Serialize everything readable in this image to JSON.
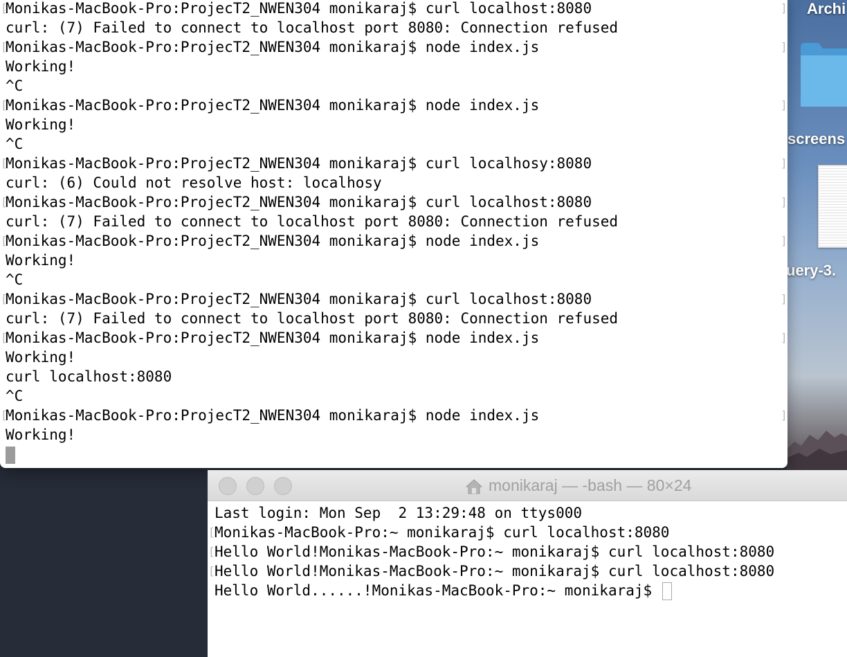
{
  "desktop": {
    "labels": [
      "Archi",
      "screens",
      "uery-3."
    ]
  },
  "terminal_main": {
    "lines": [
      {
        "text": "Monikas-MacBook-Pro:ProjecT2_NWEN304 monikaraj$ curl localhost:8080",
        "prompt": true
      },
      {
        "text": "curl: (7) Failed to connect to localhost port 8080: Connection refused",
        "prompt": false
      },
      {
        "text": "Monikas-MacBook-Pro:ProjecT2_NWEN304 monikaraj$ node index.js",
        "prompt": true
      },
      {
        "text": "Working!",
        "prompt": false
      },
      {
        "text": "^C",
        "prompt": false
      },
      {
        "text": "Monikas-MacBook-Pro:ProjecT2_NWEN304 monikaraj$ node index.js",
        "prompt": true
      },
      {
        "text": "Working!",
        "prompt": false
      },
      {
        "text": "^C",
        "prompt": false
      },
      {
        "text": "Monikas-MacBook-Pro:ProjecT2_NWEN304 monikaraj$ curl localhosy:8080",
        "prompt": true
      },
      {
        "text": "curl: (6) Could not resolve host: localhosy",
        "prompt": false
      },
      {
        "text": "Monikas-MacBook-Pro:ProjecT2_NWEN304 monikaraj$ curl localhost:8080",
        "prompt": true
      },
      {
        "text": "curl: (7) Failed to connect to localhost port 8080: Connection refused",
        "prompt": false
      },
      {
        "text": "Monikas-MacBook-Pro:ProjecT2_NWEN304 monikaraj$ node index.js",
        "prompt": true
      },
      {
        "text": "Working!",
        "prompt": false
      },
      {
        "text": "^C",
        "prompt": false
      },
      {
        "text": "Monikas-MacBook-Pro:ProjecT2_NWEN304 monikaraj$ curl localhost:8080",
        "prompt": true
      },
      {
        "text": "curl: (7) Failed to connect to localhost port 8080: Connection refused",
        "prompt": false
      },
      {
        "text": "Monikas-MacBook-Pro:ProjecT2_NWEN304 monikaraj$ node index.js",
        "prompt": true
      },
      {
        "text": "Working!",
        "prompt": false
      },
      {
        "text": "curl localhost:8080",
        "prompt": false
      },
      {
        "text": "^C",
        "prompt": false
      },
      {
        "text": "Monikas-MacBook-Pro:ProjecT2_NWEN304 monikaraj$ node index.js",
        "prompt": true
      },
      {
        "text": "Working!",
        "prompt": false
      }
    ]
  },
  "terminal_bash": {
    "title": "monikaraj — -bash — 80×24",
    "title_icon": "home-icon",
    "lines": [
      {
        "text": "Last login: Mon Sep  2 13:29:48 on ttys000",
        "prompt": false
      },
      {
        "text": "Monikas-MacBook-Pro:~ monikaraj$ curl localhost:8080",
        "prompt": true
      },
      {
        "text": "Hello World!Monikas-MacBook-Pro:~ monikaraj$ curl localhost:8080",
        "prompt": true
      },
      {
        "text": "Hello World!Monikas-MacBook-Pro:~ monikaraj$ curl localhost:8080",
        "prompt": true
      },
      {
        "text": "Hello World......!Monikas-MacBook-Pro:~ monikaraj$ ",
        "prompt": false
      }
    ]
  }
}
